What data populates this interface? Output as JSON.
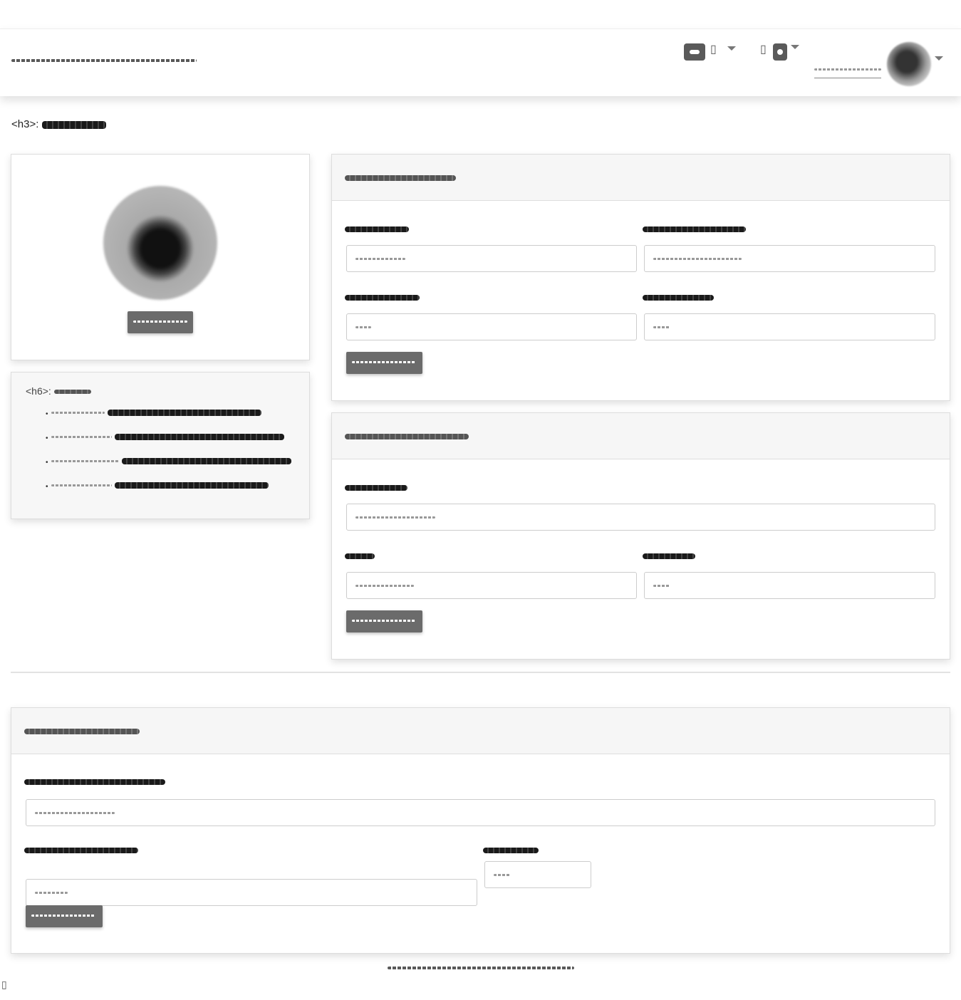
{
  "header": {
    "brand": "",
    "user_name": ""
  },
  "page": {
    "title_prefix": "<h3>:"
  },
  "profile_card": {
    "change_button": ""
  },
  "info_card": {
    "heading_prefix": "<h6>:",
    "items": [
      "",
      "",
      "",
      ""
    ]
  },
  "account_card": {
    "title": "",
    "fields": [
      {
        "label": "",
        "value": ""
      },
      {
        "label": "",
        "value": ""
      },
      {
        "label": "",
        "value": ""
      },
      {
        "label": "",
        "value": ""
      }
    ],
    "save_button": ""
  },
  "address_card": {
    "title": "",
    "fields": [
      {
        "label": "",
        "value": ""
      },
      {
        "label": "",
        "value": ""
      },
      {
        "label": "",
        "value": ""
      }
    ],
    "save_button": ""
  },
  "payment_card": {
    "title": "",
    "fields": [
      {
        "label": "",
        "value": ""
      },
      {
        "label": "",
        "value": ""
      },
      {
        "label": "",
        "value": ""
      }
    ],
    "save_button": ""
  },
  "footer": {
    "text": ""
  },
  "icons": {
    "nav_1": "message-icon",
    "nav_2": "notification-icon",
    "user_menu": "chevron-down-icon"
  },
  "colors": {
    "button": "#6b6b6b",
    "card_header": "#f6f6f6",
    "border": "#dddddd"
  }
}
